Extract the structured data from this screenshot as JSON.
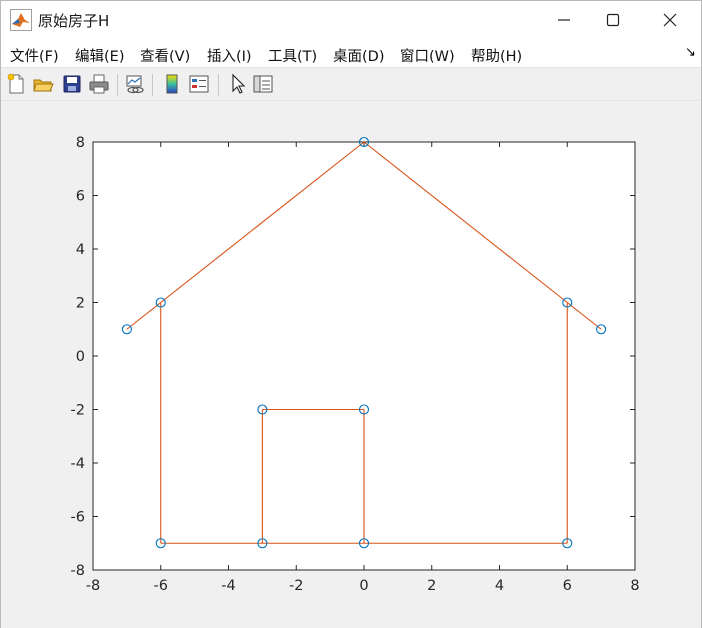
{
  "window": {
    "title": "原始房子H",
    "controls": {
      "minimize": "minimize",
      "maximize": "maximize",
      "close": "close"
    }
  },
  "menu": {
    "items": [
      "文件(F)",
      "编辑(E)",
      "查看(V)",
      "插入(I)",
      "工具(T)",
      "桌面(D)",
      "窗口(W)",
      "帮助(H)"
    ],
    "overflow": "↘"
  },
  "toolbar": {
    "buttons": [
      "new-figure-icon",
      "open-file-icon",
      "save-icon",
      "print-icon",
      "link-plot-icon",
      "insert-colorbar-icon",
      "insert-legend-icon",
      "edit-plot-arrow-icon",
      "property-inspector-icon"
    ]
  },
  "colors": {
    "line": "#d95319",
    "marker": "#0072bd",
    "axes_bg": "#ffffff",
    "figure_bg": "#f0f0f0"
  },
  "chart_data": {
    "type": "line",
    "title": "",
    "xlabel": "",
    "ylabel": "",
    "xlim": [
      -8,
      8
    ],
    "ylim": [
      -8,
      8
    ],
    "xticks": [
      -8,
      -6,
      -4,
      -2,
      0,
      2,
      4,
      6,
      8
    ],
    "yticks": [
      -8,
      -6,
      -4,
      -2,
      0,
      2,
      4,
      6,
      8
    ],
    "grid": false,
    "series": [
      {
        "style": "line",
        "color": "#d95319",
        "x": [
          -6,
          -6,
          6,
          6,
          -7,
          0,
          7,
          6,
          0,
          0,
          -3,
          -3
        ],
        "y": [
          2,
          -7,
          -7,
          2,
          1,
          8,
          1,
          2,
          8,
          -2,
          -2,
          -7
        ],
        "note": "segments listed as pairs"
      }
    ],
    "segments": [
      [
        [
          -7,
          1
        ],
        [
          0,
          8
        ]
      ],
      [
        [
          0,
          8
        ],
        [
          7,
          1
        ]
      ],
      [
        [
          -6,
          2
        ],
        [
          -6,
          -7
        ]
      ],
      [
        [
          6,
          2
        ],
        [
          6,
          -7
        ]
      ],
      [
        [
          -6,
          -7
        ],
        [
          6,
          -7
        ]
      ],
      [
        [
          -3,
          -7
        ],
        [
          -3,
          -2
        ]
      ],
      [
        [
          -3,
          -2
        ],
        [
          0,
          -2
        ]
      ],
      [
        [
          0,
          -2
        ],
        [
          0,
          -7
        ]
      ]
    ],
    "markers": {
      "style": "circle",
      "color": "#0072bd",
      "points": [
        [
          -7,
          1
        ],
        [
          -6,
          2
        ],
        [
          0,
          8
        ],
        [
          6,
          2
        ],
        [
          7,
          1
        ],
        [
          -6,
          -7
        ],
        [
          -3,
          -7
        ],
        [
          0,
          -7
        ],
        [
          6,
          -7
        ],
        [
          -3,
          -2
        ],
        [
          0,
          -2
        ]
      ]
    }
  }
}
